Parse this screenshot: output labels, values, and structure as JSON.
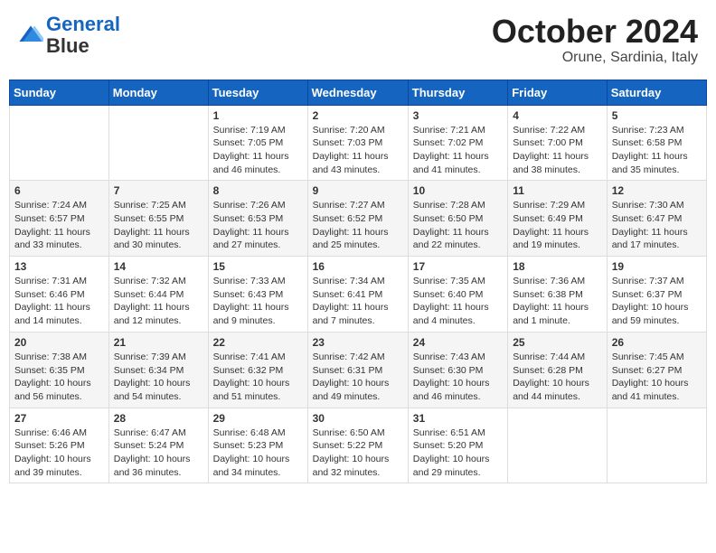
{
  "header": {
    "logo_line1": "General",
    "logo_line2": "Blue",
    "month": "October 2024",
    "location": "Orune, Sardinia, Italy"
  },
  "weekdays": [
    "Sunday",
    "Monday",
    "Tuesday",
    "Wednesday",
    "Thursday",
    "Friday",
    "Saturday"
  ],
  "weeks": [
    [
      {
        "day": "",
        "info": ""
      },
      {
        "day": "",
        "info": ""
      },
      {
        "day": "1",
        "info": "Sunrise: 7:19 AM\nSunset: 7:05 PM\nDaylight: 11 hours and 46 minutes."
      },
      {
        "day": "2",
        "info": "Sunrise: 7:20 AM\nSunset: 7:03 PM\nDaylight: 11 hours and 43 minutes."
      },
      {
        "day": "3",
        "info": "Sunrise: 7:21 AM\nSunset: 7:02 PM\nDaylight: 11 hours and 41 minutes."
      },
      {
        "day": "4",
        "info": "Sunrise: 7:22 AM\nSunset: 7:00 PM\nDaylight: 11 hours and 38 minutes."
      },
      {
        "day": "5",
        "info": "Sunrise: 7:23 AM\nSunset: 6:58 PM\nDaylight: 11 hours and 35 minutes."
      }
    ],
    [
      {
        "day": "6",
        "info": "Sunrise: 7:24 AM\nSunset: 6:57 PM\nDaylight: 11 hours and 33 minutes."
      },
      {
        "day": "7",
        "info": "Sunrise: 7:25 AM\nSunset: 6:55 PM\nDaylight: 11 hours and 30 minutes."
      },
      {
        "day": "8",
        "info": "Sunrise: 7:26 AM\nSunset: 6:53 PM\nDaylight: 11 hours and 27 minutes."
      },
      {
        "day": "9",
        "info": "Sunrise: 7:27 AM\nSunset: 6:52 PM\nDaylight: 11 hours and 25 minutes."
      },
      {
        "day": "10",
        "info": "Sunrise: 7:28 AM\nSunset: 6:50 PM\nDaylight: 11 hours and 22 minutes."
      },
      {
        "day": "11",
        "info": "Sunrise: 7:29 AM\nSunset: 6:49 PM\nDaylight: 11 hours and 19 minutes."
      },
      {
        "day": "12",
        "info": "Sunrise: 7:30 AM\nSunset: 6:47 PM\nDaylight: 11 hours and 17 minutes."
      }
    ],
    [
      {
        "day": "13",
        "info": "Sunrise: 7:31 AM\nSunset: 6:46 PM\nDaylight: 11 hours and 14 minutes."
      },
      {
        "day": "14",
        "info": "Sunrise: 7:32 AM\nSunset: 6:44 PM\nDaylight: 11 hours and 12 minutes."
      },
      {
        "day": "15",
        "info": "Sunrise: 7:33 AM\nSunset: 6:43 PM\nDaylight: 11 hours and 9 minutes."
      },
      {
        "day": "16",
        "info": "Sunrise: 7:34 AM\nSunset: 6:41 PM\nDaylight: 11 hours and 7 minutes."
      },
      {
        "day": "17",
        "info": "Sunrise: 7:35 AM\nSunset: 6:40 PM\nDaylight: 11 hours and 4 minutes."
      },
      {
        "day": "18",
        "info": "Sunrise: 7:36 AM\nSunset: 6:38 PM\nDaylight: 11 hours and 1 minute."
      },
      {
        "day": "19",
        "info": "Sunrise: 7:37 AM\nSunset: 6:37 PM\nDaylight: 10 hours and 59 minutes."
      }
    ],
    [
      {
        "day": "20",
        "info": "Sunrise: 7:38 AM\nSunset: 6:35 PM\nDaylight: 10 hours and 56 minutes."
      },
      {
        "day": "21",
        "info": "Sunrise: 7:39 AM\nSunset: 6:34 PM\nDaylight: 10 hours and 54 minutes."
      },
      {
        "day": "22",
        "info": "Sunrise: 7:41 AM\nSunset: 6:32 PM\nDaylight: 10 hours and 51 minutes."
      },
      {
        "day": "23",
        "info": "Sunrise: 7:42 AM\nSunset: 6:31 PM\nDaylight: 10 hours and 49 minutes."
      },
      {
        "day": "24",
        "info": "Sunrise: 7:43 AM\nSunset: 6:30 PM\nDaylight: 10 hours and 46 minutes."
      },
      {
        "day": "25",
        "info": "Sunrise: 7:44 AM\nSunset: 6:28 PM\nDaylight: 10 hours and 44 minutes."
      },
      {
        "day": "26",
        "info": "Sunrise: 7:45 AM\nSunset: 6:27 PM\nDaylight: 10 hours and 41 minutes."
      }
    ],
    [
      {
        "day": "27",
        "info": "Sunrise: 6:46 AM\nSunset: 5:26 PM\nDaylight: 10 hours and 39 minutes."
      },
      {
        "day": "28",
        "info": "Sunrise: 6:47 AM\nSunset: 5:24 PM\nDaylight: 10 hours and 36 minutes."
      },
      {
        "day": "29",
        "info": "Sunrise: 6:48 AM\nSunset: 5:23 PM\nDaylight: 10 hours and 34 minutes."
      },
      {
        "day": "30",
        "info": "Sunrise: 6:50 AM\nSunset: 5:22 PM\nDaylight: 10 hours and 32 minutes."
      },
      {
        "day": "31",
        "info": "Sunrise: 6:51 AM\nSunset: 5:20 PM\nDaylight: 10 hours and 29 minutes."
      },
      {
        "day": "",
        "info": ""
      },
      {
        "day": "",
        "info": ""
      }
    ]
  ]
}
